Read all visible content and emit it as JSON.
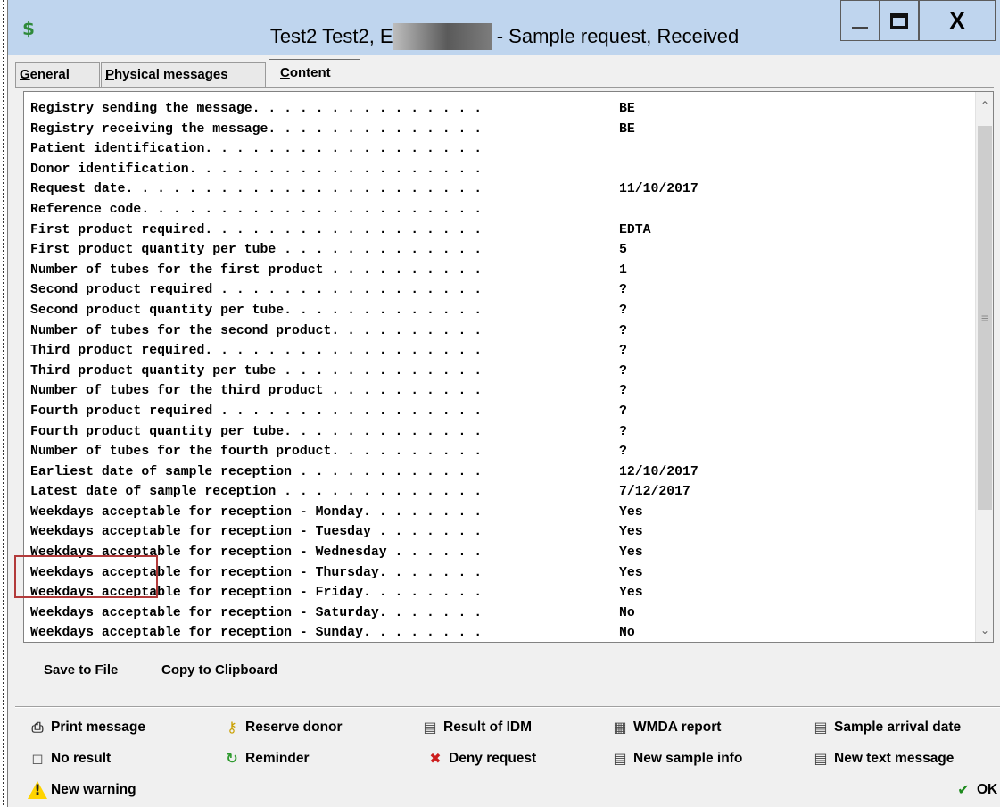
{
  "window": {
    "title_prefix": "Test2 Test2, E",
    "title_suffix": "- Sample request, Received",
    "close_label": "X"
  },
  "tabs": [
    {
      "label": "General",
      "active": false
    },
    {
      "label": "Physical messages",
      "active": false
    },
    {
      "label": "Content",
      "active": true
    }
  ],
  "content": {
    "lines": [
      {
        "label": "Registry sending the message. . . . . . . . . . . . . . .",
        "value": "BE"
      },
      {
        "label": "Registry receiving the message. . . . . . . . . . . . . .",
        "value": "BE"
      },
      {
        "label": "Patient identification. . . . . . . . . . . . . . . . . .",
        "value": ""
      },
      {
        "label": "Donor identification. . . . . . . . . . . . . . . . . . .",
        "value": ""
      },
      {
        "label": "Request date. . . . . . . . . . . . . . . . . . . . . . .",
        "value": "11/10/2017"
      },
      {
        "label": "Reference code. . . . . . . . . . . . . . . . . . . . . .",
        "value": ""
      },
      {
        "label": "First product required. . . . . . . . . . . . . . . . . .",
        "value": "EDTA"
      },
      {
        "label": "First product quantity per tube . . . . . . . . . . . . .",
        "value": "5"
      },
      {
        "label": "Number of tubes for the first product . . . . . . . . . .",
        "value": "1"
      },
      {
        "label": "Second product required . . . . . . . . . . . . . . . . .",
        "value": "?"
      },
      {
        "label": "Second product quantity per tube. . . . . . . . . . . . .",
        "value": "?"
      },
      {
        "label": "Number of tubes for the second product. . . . . . . . . .",
        "value": "?"
      },
      {
        "label": "Third product required. . . . . . . . . . . . . . . . . .",
        "value": "?"
      },
      {
        "label": "Third product quantity per tube . . . . . . . . . . . . .",
        "value": "?"
      },
      {
        "label": "Number of tubes for the third product . . . . . . . . . .",
        "value": "?"
      },
      {
        "label": "Fourth product required . . . . . . . . . . . . . . . . .",
        "value": "?"
      },
      {
        "label": "Fourth product quantity per tube. . . . . . . . . . . . .",
        "value": "?"
      },
      {
        "label": "Number of tubes for the fourth product. . . . . . . . . .",
        "value": "?"
      },
      {
        "label": "Earliest date of sample reception . . . . . . . . . . . .",
        "value": "12/10/2017"
      },
      {
        "label": "Latest date of sample reception . . . . . . . . . . . . .",
        "value": "7/12/2017"
      },
      {
        "label": "Weekdays acceptable for reception - Monday. . . . . . . .",
        "value": "Yes"
      },
      {
        "label": "Weekdays acceptable for reception - Tuesday . . . . . . .",
        "value": "Yes"
      },
      {
        "label": "Weekdays acceptable for reception - Wednesday . . . . . .",
        "value": "Yes"
      },
      {
        "label": "Weekdays acceptable for reception - Thursday. . . . . . .",
        "value": "Yes"
      },
      {
        "label": "Weekdays acceptable for reception - Friday. . . . . . . .",
        "value": "Yes"
      },
      {
        "label": "Weekdays acceptable for reception - Saturday. . . . . . .",
        "value": "No"
      },
      {
        "label": "Weekdays acceptable for reception - Sunday. . . . . . . .",
        "value": "No"
      }
    ]
  },
  "file_actions": {
    "save": "Save to File",
    "copy": "Copy to Clipboard"
  },
  "commands": {
    "print": "Print message",
    "reserve": "Reserve donor",
    "result_idm": "Result of IDM",
    "wmda": "WMDA report",
    "sample_arrival": "Sample arrival date",
    "no_result": "No result",
    "reminder": "Reminder",
    "deny": "Deny request",
    "new_sample_info": "New sample info",
    "new_text_message": "New text message",
    "new_warning": "New warning",
    "ok": "OK"
  }
}
